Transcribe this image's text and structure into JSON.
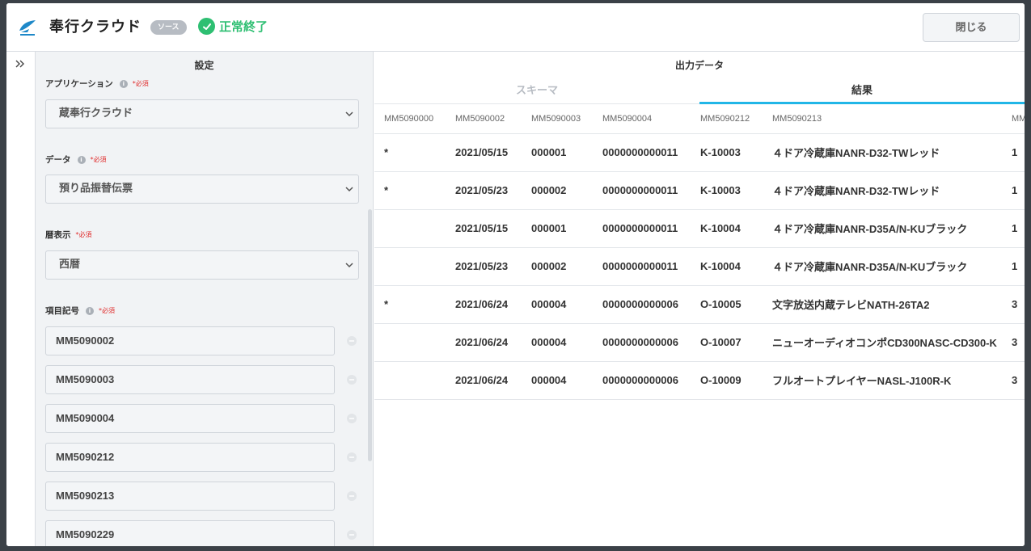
{
  "header": {
    "title": "奉行クラウド",
    "badge": "ソース",
    "status": "正常終了",
    "close_label": "閉じる"
  },
  "settings": {
    "title": "設定",
    "required_mark": "*必須",
    "fields": [
      {
        "label": "アプリケーション",
        "value": "蔵奉行クラウド"
      },
      {
        "label": "データ",
        "value": "預り品振替伝票"
      },
      {
        "label": "暦表示",
        "value": "西暦"
      }
    ],
    "item_codes_label": "項目記号",
    "item_codes": [
      "MM5090002",
      "MM5090003",
      "MM5090004",
      "MM5090212",
      "MM5090213",
      "MM5090229"
    ]
  },
  "output": {
    "title": "出力データ",
    "tabs": [
      "スキーマ",
      "結果"
    ],
    "active_tab": "結果",
    "columns": [
      "MM5090000",
      "MM5090002",
      "MM5090003",
      "MM5090004",
      "MM5090212",
      "MM5090213",
      "MM"
    ],
    "rows": [
      [
        "*",
        "2021/05/15",
        "000001",
        "0000000000011",
        "K-10003",
        "４ドア冷蔵庫NANR-D32-TWレッド",
        "1"
      ],
      [
        "*",
        "2021/05/23",
        "000002",
        "0000000000011",
        "K-10003",
        "４ドア冷蔵庫NANR-D32-TWレッド",
        "1"
      ],
      [
        "",
        "2021/05/15",
        "000001",
        "0000000000011",
        "K-10004",
        "４ドア冷蔵庫NANR-D35A/N-KUブラック",
        "1"
      ],
      [
        "",
        "2021/05/23",
        "000002",
        "0000000000011",
        "K-10004",
        "４ドア冷蔵庫NANR-D35A/N-KUブラック",
        "1"
      ],
      [
        "*",
        "2021/06/24",
        "000004",
        "0000000000006",
        "O-10005",
        "文字放送内蔵テレビNATH-26TA2",
        "3"
      ],
      [
        "",
        "2021/06/24",
        "000004",
        "0000000000006",
        "O-10007",
        "ニューオーディオコンポCD300NASC-CD300-K",
        "3"
      ],
      [
        "",
        "2021/06/24",
        "000004",
        "0000000000006",
        "O-10009",
        "フルオートプレイヤーNASL-J100R-K",
        "3"
      ]
    ]
  },
  "colors": {
    "success": "#2ebf72",
    "accent": "#21b6e7",
    "required": "#e02d2d"
  }
}
